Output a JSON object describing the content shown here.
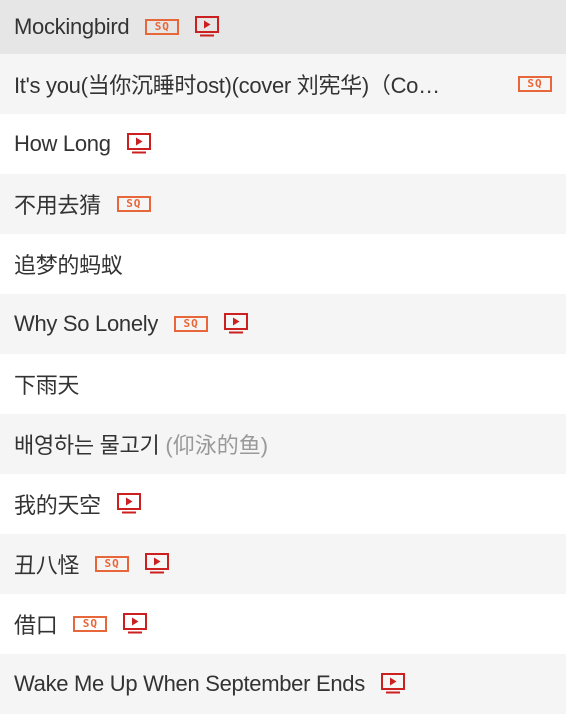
{
  "colors": {
    "selected_row": "#e6e6e6",
    "striped_row": "#f5f5f5",
    "sq_badge": "#e8673a",
    "mv_icon": "#cc1f1f",
    "title_text": "#333333",
    "alias_text": "#999999"
  },
  "songs": [
    {
      "title": "Mockingbird",
      "alias": "",
      "sq": true,
      "mv": true,
      "selected": true
    },
    {
      "title": "It's you(当你沉睡时ost)(cover 刘宪华)（Co…",
      "alias": "",
      "sq": true,
      "mv": false,
      "selected": false
    },
    {
      "title": "How Long",
      "alias": "",
      "sq": false,
      "mv": true,
      "selected": false
    },
    {
      "title": "不用去猜",
      "alias": "",
      "sq": true,
      "mv": false,
      "selected": false
    },
    {
      "title": "追梦的蚂蚁",
      "alias": "",
      "sq": false,
      "mv": false,
      "selected": false
    },
    {
      "title": "Why So Lonely",
      "alias": "",
      "sq": true,
      "mv": true,
      "selected": false
    },
    {
      "title": "下雨天",
      "alias": "",
      "sq": false,
      "mv": false,
      "selected": false
    },
    {
      "title": "배영하는 물고기",
      "alias": "(仰泳的鱼)",
      "sq": false,
      "mv": false,
      "selected": false
    },
    {
      "title": "我的天空",
      "alias": "",
      "sq": false,
      "mv": true,
      "selected": false
    },
    {
      "title": "丑八怪",
      "alias": "",
      "sq": true,
      "mv": true,
      "selected": false
    },
    {
      "title": "借口",
      "alias": "",
      "sq": true,
      "mv": true,
      "selected": false
    },
    {
      "title": "Wake Me Up When September Ends",
      "alias": "",
      "sq": false,
      "mv": true,
      "selected": false
    }
  ],
  "badges": {
    "sq_label": "SQ",
    "mv_icon": "mv-play-icon"
  }
}
